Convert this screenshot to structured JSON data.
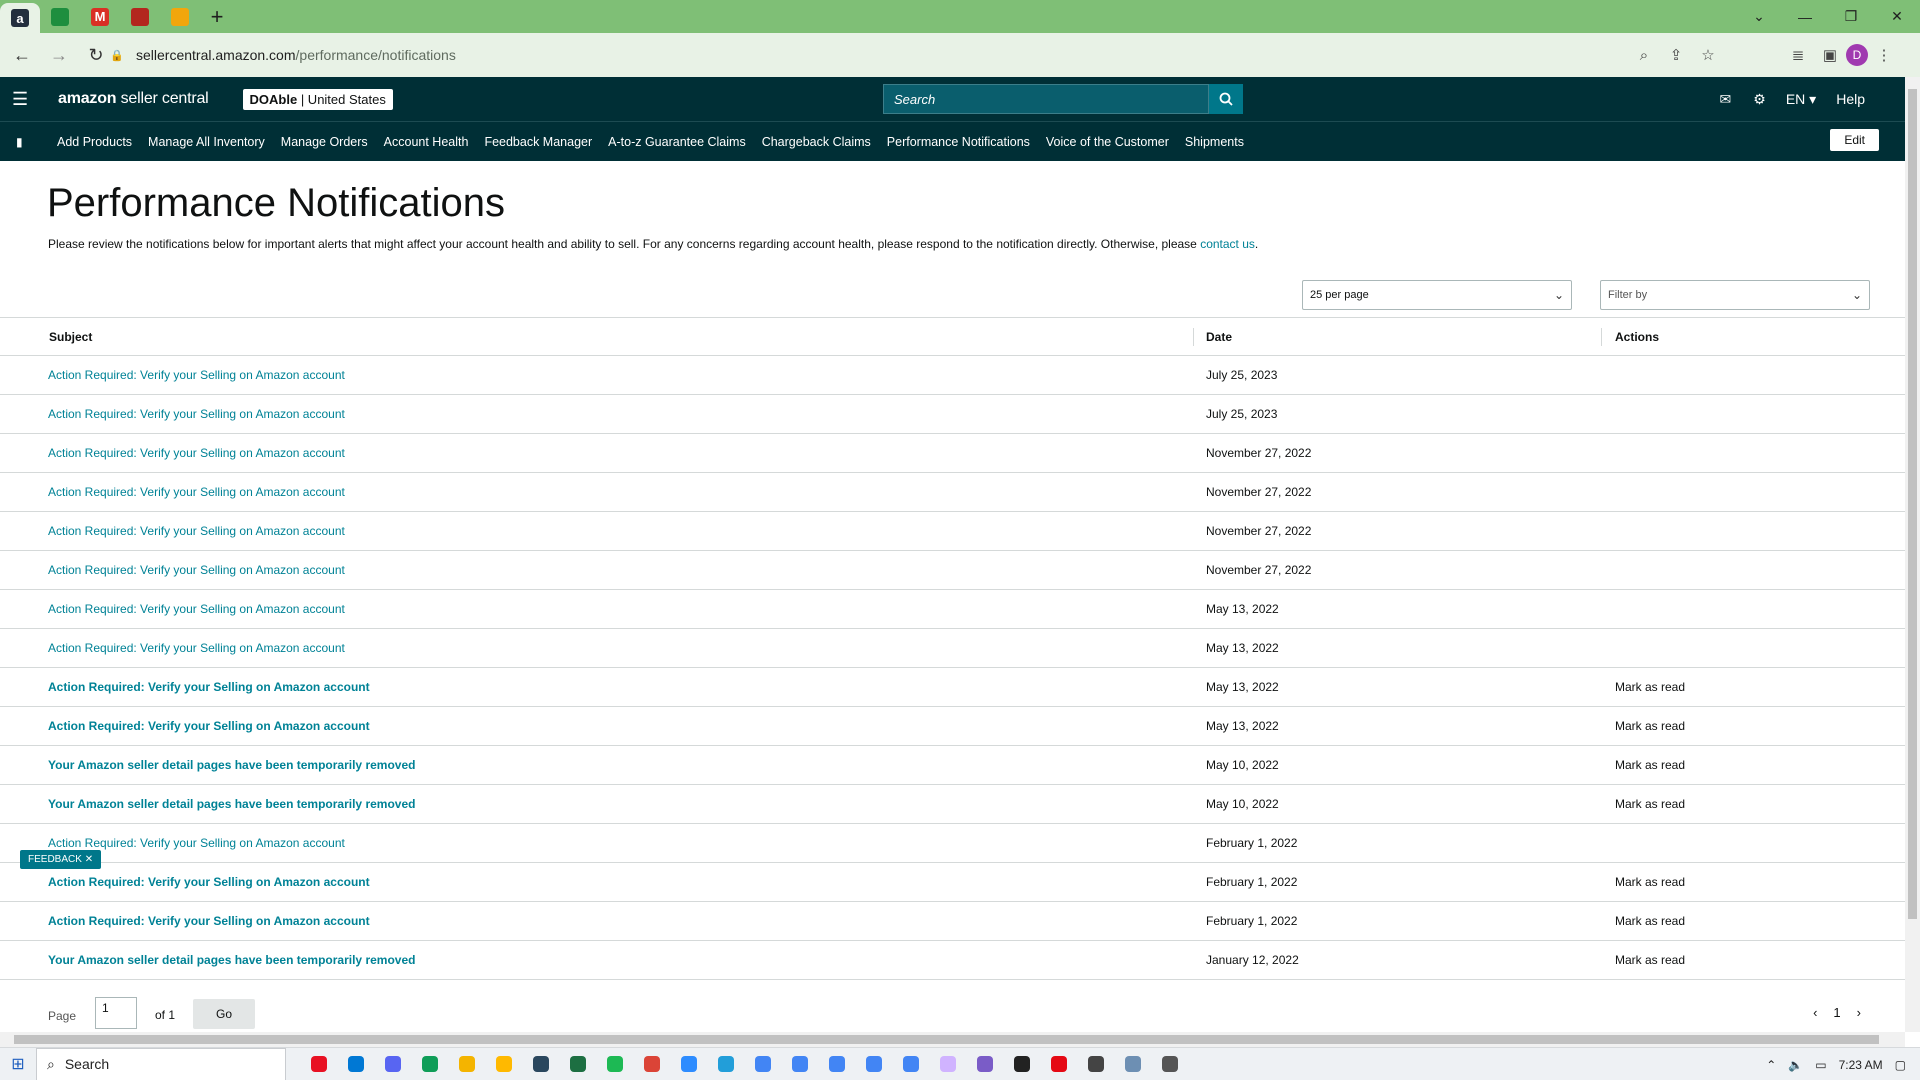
{
  "browser": {
    "tabs": [
      {
        "label": "a",
        "color": "#232f3e"
      },
      {
        "label": "",
        "color": "#1e8e3e"
      },
      {
        "label": "M",
        "color": "#d93025"
      },
      {
        "label": "",
        "color": "#b3261e"
      },
      {
        "label": "",
        "color": "#f2a60c"
      }
    ],
    "url_host": "sellercentral.amazon.com",
    "url_path": "/performance/notifications",
    "profile_initial": "D"
  },
  "header": {
    "logo_main": "amazon",
    "logo_sub": " seller central",
    "store_name": "DOAble",
    "store_region": " | United States",
    "search_placeholder": "Search",
    "language": "EN",
    "help": "Help"
  },
  "nav": {
    "links": [
      "Add Products",
      "Manage All Inventory",
      "Manage Orders",
      "Account Health",
      "Feedback Manager",
      "A-to-z Guarantee Claims",
      "Chargeback Claims",
      "Performance Notifications",
      "Voice of the Customer",
      "Shipments"
    ],
    "edit": "Edit"
  },
  "page": {
    "title": "Performance Notifications",
    "intro": "Please review the notifications below for important alerts that might affect your account health and ability to sell. For any concerns regarding account health, please respond to the notification directly. Otherwise, please ",
    "intro_link": "contact us",
    "intro_end": ".",
    "per_page": "25 per page",
    "filter": "Filter by"
  },
  "table": {
    "headers": {
      "subject": "Subject",
      "date": "Date",
      "actions": "Actions"
    },
    "rows": [
      {
        "subject": "Action Required: Verify your Selling on Amazon account",
        "date": "July 25, 2023",
        "action": "",
        "unread": false
      },
      {
        "subject": "Action Required: Verify your Selling on Amazon account",
        "date": "July 25, 2023",
        "action": "",
        "unread": false
      },
      {
        "subject": "Action Required: Verify your Selling on Amazon account",
        "date": "November 27, 2022",
        "action": "",
        "unread": false
      },
      {
        "subject": "Action Required: Verify your Selling on Amazon account",
        "date": "November 27, 2022",
        "action": "",
        "unread": false
      },
      {
        "subject": "Action Required: Verify your Selling on Amazon account",
        "date": "November 27, 2022",
        "action": "",
        "unread": false
      },
      {
        "subject": "Action Required: Verify your Selling on Amazon account",
        "date": "November 27, 2022",
        "action": "",
        "unread": false
      },
      {
        "subject": "Action Required: Verify your Selling on Amazon account",
        "date": "May 13, 2022",
        "action": "",
        "unread": false
      },
      {
        "subject": "Action Required: Verify your Selling on Amazon account",
        "date": "May 13, 2022",
        "action": "",
        "unread": false
      },
      {
        "subject": "Action Required: Verify your Selling on Amazon account",
        "date": "May 13, 2022",
        "action": "Mark as read",
        "unread": true
      },
      {
        "subject": "Action Required: Verify your Selling on Amazon account",
        "date": "May 13, 2022",
        "action": "Mark as read",
        "unread": true
      },
      {
        "subject": "Your Amazon seller detail pages have been temporarily removed",
        "date": "May 10, 2022",
        "action": "Mark as read",
        "unread": true
      },
      {
        "subject": "Your Amazon seller detail pages have been temporarily removed",
        "date": "May 10, 2022",
        "action": "Mark as read",
        "unread": true
      },
      {
        "subject": "Action Required: Verify your Selling on Amazon account",
        "date": "February 1, 2022",
        "action": "",
        "unread": false
      },
      {
        "subject": "Action Required: Verify your Selling on Amazon account",
        "date": "February 1, 2022",
        "action": "Mark as read",
        "unread": true
      },
      {
        "subject": "Action Required: Verify your Selling on Amazon account",
        "date": "February 1, 2022",
        "action": "Mark as read",
        "unread": true
      },
      {
        "subject": "Your Amazon seller detail pages have been temporarily removed",
        "date": "January 12, 2022",
        "action": "Mark as read",
        "unread": true
      }
    ]
  },
  "pager": {
    "label": "Page",
    "page_value": "1",
    "of": "of 1",
    "go": "Go",
    "current": "1"
  },
  "feedback": "FEEDBACK",
  "taskbar": {
    "search": "Search",
    "time": "7:23 AM",
    "app_colors": [
      "#e81123",
      "#0078d4",
      "#5865f2",
      "#0f9d58",
      "#f4b400",
      "#ffb900",
      "#2a475e",
      "#1d6f42",
      "#1db954",
      "#db4437",
      "#2d8cff",
      "#229ed9",
      "#4285f4",
      "#4285f4",
      "#4285f4",
      "#4285f4",
      "#4285f4",
      "#d0b3ff",
      "#7a5cc7",
      "#222222",
      "#e50914",
      "#444444",
      "#6d8fb3",
      "#555555"
    ]
  }
}
